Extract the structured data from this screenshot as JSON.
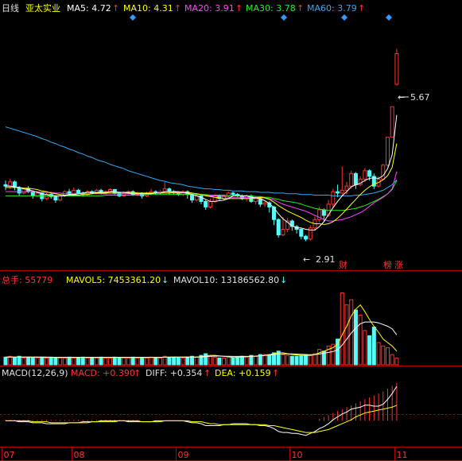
{
  "header": {
    "period": "日线",
    "stock": "亚太实业",
    "ma": [
      {
        "label": "MA5: 4.72",
        "color": "#ffffff"
      },
      {
        "label": "MA10: 4.31",
        "color": "#ffff00"
      },
      {
        "label": "MA20: 3.91",
        "color": "#ff44ff"
      },
      {
        "label": "MA30: 3.78",
        "color": "#22ee22"
      },
      {
        "label": "MA60: 3.79",
        "color": "#33aaee"
      }
    ],
    "arrow": "↑"
  },
  "annotations": {
    "high": "5.67",
    "low": "2.91",
    "tag_cai": "财",
    "tag_bang": "榜",
    "tag_zhang": "涨"
  },
  "volume_header": {
    "total": "总手: 55779",
    "mavol5": "MAVOL5: 7453361.20",
    "mavol10": "MAVOL10: 13186562.80",
    "up_arrow": "↑",
    "down_arrow": "↓"
  },
  "macd_header": {
    "name": "MACD(12,26,9)",
    "macd": "MACD: +0.390",
    "diff": "DIFF: +0.354",
    "dea": "DEA: +0.159",
    "up_arrow": "↑"
  },
  "months": [
    "07",
    "08",
    "09",
    "10",
    "11"
  ],
  "colors": {
    "up": "#ff3232",
    "down": "#54fcfc",
    "axis": "#b00000",
    "ma5": "#ffffff",
    "ma10": "#ffff00",
    "ma20": "#ff44ff",
    "ma30": "#22ee22",
    "ma60": "#33aaee"
  },
  "chart_data": {
    "type": "candlestick",
    "candles": [
      [
        3.72,
        3.7,
        3.78,
        3.64
      ],
      [
        3.7,
        3.76,
        3.8,
        3.66
      ],
      [
        3.76,
        3.68,
        3.78,
        3.64
      ],
      [
        3.68,
        3.6,
        3.7,
        3.56
      ],
      [
        3.6,
        3.66,
        3.68,
        3.58
      ],
      [
        3.66,
        3.62,
        3.7,
        3.6
      ],
      [
        3.62,
        3.56,
        3.64,
        3.52
      ],
      [
        3.56,
        3.6,
        3.62,
        3.54
      ],
      [
        3.6,
        3.52,
        3.62,
        3.48
      ],
      [
        3.52,
        3.58,
        3.6,
        3.5
      ],
      [
        3.58,
        3.55,
        3.6,
        3.52
      ],
      [
        3.55,
        3.5,
        3.57,
        3.46
      ],
      [
        3.5,
        3.56,
        3.58,
        3.48
      ],
      [
        3.56,
        3.62,
        3.64,
        3.54
      ],
      [
        3.62,
        3.58,
        3.66,
        3.56
      ],
      [
        3.58,
        3.64,
        3.68,
        3.56
      ],
      [
        3.64,
        3.6,
        3.66,
        3.58
      ],
      [
        3.6,
        3.58,
        3.62,
        3.55
      ],
      [
        3.58,
        3.62,
        3.64,
        3.56
      ],
      [
        3.62,
        3.6,
        3.64,
        3.58
      ],
      [
        3.6,
        3.64,
        3.66,
        3.59
      ],
      [
        3.64,
        3.6,
        3.66,
        3.58
      ],
      [
        3.6,
        3.62,
        3.64,
        3.58
      ],
      [
        3.62,
        3.65,
        3.67,
        3.6
      ],
      [
        3.65,
        3.6,
        3.66,
        3.58
      ],
      [
        3.6,
        3.56,
        3.62,
        3.54
      ],
      [
        3.56,
        3.6,
        3.62,
        3.55
      ],
      [
        3.6,
        3.62,
        3.64,
        3.58
      ],
      [
        3.62,
        3.58,
        3.64,
        3.56
      ],
      [
        3.58,
        3.6,
        3.62,
        3.56
      ],
      [
        3.6,
        3.56,
        3.61,
        3.52
      ],
      [
        3.56,
        3.6,
        3.62,
        3.54
      ],
      [
        3.6,
        3.62,
        3.66,
        3.58
      ],
      [
        3.62,
        3.6,
        3.64,
        3.58
      ],
      [
        3.6,
        3.62,
        3.64,
        3.58
      ],
      [
        3.62,
        3.66,
        3.76,
        3.6
      ],
      [
        3.66,
        3.62,
        3.68,
        3.58
      ],
      [
        3.62,
        3.6,
        3.64,
        3.58
      ],
      [
        3.6,
        3.58,
        3.62,
        3.56
      ],
      [
        3.58,
        3.62,
        3.64,
        3.56
      ],
      [
        3.62,
        3.58,
        3.64,
        3.52
      ],
      [
        3.58,
        3.5,
        3.6,
        3.46
      ],
      [
        3.5,
        3.56,
        3.58,
        3.48
      ],
      [
        3.56,
        3.48,
        3.58,
        3.44
      ],
      [
        3.48,
        3.4,
        3.5,
        3.36
      ],
      [
        3.4,
        3.48,
        3.52,
        3.38
      ],
      [
        3.48,
        3.56,
        3.58,
        3.46
      ],
      [
        3.56,
        3.52,
        3.58,
        3.5
      ],
      [
        3.52,
        3.56,
        3.58,
        3.5
      ],
      [
        3.56,
        3.6,
        3.62,
        3.54
      ],
      [
        3.6,
        3.58,
        3.62,
        3.56
      ],
      [
        3.58,
        3.56,
        3.6,
        3.54
      ],
      [
        3.56,
        3.52,
        3.58,
        3.5
      ],
      [
        3.52,
        3.56,
        3.58,
        3.48
      ],
      [
        3.56,
        3.48,
        3.58,
        3.46
      ],
      [
        3.48,
        3.52,
        3.54,
        3.44
      ],
      [
        3.52,
        3.44,
        3.54,
        3.4
      ],
      [
        3.44,
        3.46,
        3.48,
        3.4
      ],
      [
        3.46,
        3.4,
        3.48,
        3.32
      ],
      [
        3.4,
        3.22,
        3.42,
        3.14
      ],
      [
        3.22,
        3.0,
        3.24,
        2.96
      ],
      [
        3.0,
        3.08,
        3.26,
        2.98
      ],
      [
        3.08,
        3.2,
        3.24,
        3.04
      ],
      [
        3.2,
        3.12,
        3.22,
        3.06
      ],
      [
        3.12,
        3.08,
        3.14,
        3.02
      ],
      [
        3.08,
        2.98,
        3.1,
        2.94
      ],
      [
        2.98,
        2.94,
        3.0,
        2.91
      ],
      [
        2.94,
        3.1,
        3.14,
        2.92
      ],
      [
        3.1,
        3.22,
        3.26,
        3.06
      ],
      [
        3.22,
        3.36,
        3.4,
        3.18
      ],
      [
        3.36,
        3.28,
        3.38,
        3.2
      ],
      [
        3.28,
        3.44,
        3.5,
        3.26
      ],
      [
        3.44,
        3.62,
        3.66,
        3.4
      ],
      [
        3.62,
        3.6,
        3.72,
        3.54
      ],
      [
        3.6,
        3.64,
        3.98,
        3.56
      ],
      [
        3.64,
        3.7,
        3.76,
        3.58
      ],
      [
        3.7,
        3.88,
        3.92,
        3.66
      ],
      [
        3.88,
        3.72,
        3.9,
        3.66
      ],
      [
        3.72,
        3.8,
        3.84,
        3.7
      ],
      [
        3.8,
        3.92,
        3.96,
        3.76
      ],
      [
        3.92,
        3.84,
        3.94,
        3.78
      ],
      [
        3.84,
        3.7,
        3.88,
        3.66
      ],
      [
        3.7,
        3.8,
        3.84,
        3.68
      ],
      [
        3.8,
        4.0,
        4.02,
        3.78
      ],
      [
        4.0,
        4.4,
        4.4,
        3.98
      ],
      [
        4.4,
        4.84,
        4.84,
        4.4
      ],
      [
        5.16,
        5.6,
        5.67,
        5.14
      ]
    ],
    "ma5": [
      3.7,
      3.7,
      3.69,
      3.68,
      3.66,
      3.65,
      3.63,
      3.61,
      3.59,
      3.58,
      3.57,
      3.56,
      3.56,
      3.56,
      3.58,
      3.58,
      3.59,
      3.6,
      3.61,
      3.61,
      3.61,
      3.61,
      3.61,
      3.62,
      3.62,
      3.61,
      3.61,
      3.6,
      3.59,
      3.59,
      3.59,
      3.59,
      3.59,
      3.6,
      3.6,
      3.62,
      3.62,
      3.62,
      3.62,
      3.61,
      3.6,
      3.58,
      3.56,
      3.54,
      3.51,
      3.48,
      3.48,
      3.49,
      3.5,
      3.52,
      3.56,
      3.57,
      3.56,
      3.56,
      3.54,
      3.53,
      3.52,
      3.49,
      3.45,
      3.39,
      3.3,
      3.23,
      3.18,
      3.13,
      3.1,
      3.1,
      3.08,
      3.07,
      3.07,
      3.12,
      3.19,
      3.29,
      3.39,
      3.48,
      3.56,
      3.62,
      3.69,
      3.72,
      3.74,
      3.78,
      3.81,
      3.82,
      3.81,
      3.85,
      3.95,
      4.15,
      4.72
    ],
    "ma10": [
      3.68,
      3.68,
      3.68,
      3.68,
      3.67,
      3.67,
      3.66,
      3.65,
      3.63,
      3.62,
      3.6,
      3.59,
      3.58,
      3.57,
      3.57,
      3.57,
      3.57,
      3.58,
      3.58,
      3.59,
      3.6,
      3.6,
      3.6,
      3.61,
      3.61,
      3.61,
      3.61,
      3.61,
      3.61,
      3.6,
      3.6,
      3.6,
      3.6,
      3.6,
      3.6,
      3.6,
      3.6,
      3.61,
      3.61,
      3.61,
      3.61,
      3.6,
      3.59,
      3.58,
      3.56,
      3.55,
      3.54,
      3.53,
      3.52,
      3.52,
      3.52,
      3.52,
      3.52,
      3.52,
      3.52,
      3.53,
      3.54,
      3.53,
      3.51,
      3.47,
      3.42,
      3.38,
      3.34,
      3.31,
      3.28,
      3.25,
      3.21,
      3.18,
      3.16,
      3.16,
      3.15,
      3.16,
      3.19,
      3.24,
      3.3,
      3.37,
      3.44,
      3.51,
      3.58,
      3.64,
      3.69,
      3.73,
      3.75,
      3.79,
      3.85,
      3.97,
      4.31
    ],
    "ma20": [
      3.62,
      3.62,
      3.62,
      3.62,
      3.62,
      3.62,
      3.62,
      3.62,
      3.61,
      3.61,
      3.61,
      3.6,
      3.6,
      3.59,
      3.59,
      3.59,
      3.59,
      3.59,
      3.59,
      3.59,
      3.59,
      3.59,
      3.59,
      3.59,
      3.59,
      3.59,
      3.59,
      3.59,
      3.59,
      3.59,
      3.59,
      3.59,
      3.59,
      3.6,
      3.6,
      3.6,
      3.6,
      3.6,
      3.6,
      3.6,
      3.6,
      3.6,
      3.59,
      3.58,
      3.57,
      3.56,
      3.56,
      3.55,
      3.55,
      3.54,
      3.54,
      3.54,
      3.54,
      3.54,
      3.54,
      3.54,
      3.54,
      3.53,
      3.52,
      3.5,
      3.47,
      3.44,
      3.42,
      3.4,
      3.38,
      3.36,
      3.34,
      3.31,
      3.28,
      3.25,
      3.22,
      3.2,
      3.2,
      3.21,
      3.22,
      3.24,
      3.26,
      3.29,
      3.32,
      3.36,
      3.41,
      3.46,
      3.5,
      3.54,
      3.59,
      3.66,
      3.91
    ],
    "ma30": [
      3.56,
      3.56,
      3.56,
      3.56,
      3.56,
      3.56,
      3.56,
      3.56,
      3.56,
      3.56,
      3.56,
      3.56,
      3.56,
      3.56,
      3.56,
      3.56,
      3.56,
      3.56,
      3.56,
      3.56,
      3.56,
      3.56,
      3.57,
      3.57,
      3.57,
      3.57,
      3.57,
      3.57,
      3.57,
      3.57,
      3.57,
      3.58,
      3.58,
      3.58,
      3.58,
      3.58,
      3.58,
      3.58,
      3.58,
      3.58,
      3.58,
      3.58,
      3.58,
      3.58,
      3.58,
      3.57,
      3.57,
      3.57,
      3.57,
      3.56,
      3.56,
      3.56,
      3.56,
      3.56,
      3.56,
      3.55,
      3.55,
      3.54,
      3.54,
      3.52,
      3.51,
      3.49,
      3.48,
      3.47,
      3.46,
      3.44,
      3.42,
      3.4,
      3.38,
      3.37,
      3.36,
      3.35,
      3.35,
      3.35,
      3.35,
      3.36,
      3.37,
      3.38,
      3.4,
      3.42,
      3.45,
      3.48,
      3.51,
      3.55,
      3.59,
      3.65,
      3.78
    ],
    "ma60": [
      4.55,
      4.53,
      4.51,
      4.49,
      4.47,
      4.45,
      4.43,
      4.41,
      4.38,
      4.36,
      4.33,
      4.31,
      4.28,
      4.26,
      4.23,
      4.21,
      4.18,
      4.16,
      4.13,
      4.11,
      4.08,
      4.06,
      4.04,
      4.01,
      3.99,
      3.97,
      3.95,
      3.92,
      3.9,
      3.88,
      3.86,
      3.84,
      3.82,
      3.8,
      3.78,
      3.77,
      3.75,
      3.74,
      3.73,
      3.72,
      3.7,
      3.69,
      3.68,
      3.67,
      3.66,
      3.66,
      3.65,
      3.65,
      3.64,
      3.64,
      3.63,
      3.63,
      3.63,
      3.62,
      3.62,
      3.62,
      3.61,
      3.61,
      3.61,
      3.6,
      3.6,
      3.6,
      3.59,
      3.59,
      3.59,
      3.58,
      3.58,
      3.58,
      3.57,
      3.57,
      3.57,
      3.57,
      3.56,
      3.56,
      3.56,
      3.56,
      3.56,
      3.57,
      3.57,
      3.58,
      3.59,
      3.6,
      3.62,
      3.64,
      3.68,
      3.72,
      3.79
    ],
    "volume": [
      9,
      10,
      8,
      10,
      8,
      9,
      8,
      8,
      9,
      8,
      9,
      8,
      8,
      8,
      9,
      8,
      8,
      9,
      8,
      8,
      8,
      9,
      8,
      8,
      9,
      8,
      8,
      8,
      9,
      8,
      8,
      8,
      9,
      8,
      8,
      10,
      9,
      9,
      8,
      8,
      9,
      10,
      9,
      11,
      13,
      10,
      9,
      8,
      8,
      9,
      8,
      9,
      10,
      9,
      11,
      10,
      12,
      12,
      12,
      14,
      16,
      12,
      11,
      10,
      10,
      11,
      12,
      11,
      13,
      18,
      16,
      22,
      24,
      30,
      84,
      70,
      76,
      64,
      58,
      40,
      34,
      44,
      26,
      22,
      20,
      12,
      8
    ],
    "mavol5": [
      9,
      9,
      9,
      9,
      9,
      9,
      9,
      9,
      8.5,
      8.5,
      8.5,
      8.5,
      8.5,
      8.5,
      8.5,
      8.5,
      8.5,
      8.5,
      8.5,
      8.5,
      8.5,
      8.5,
      8.5,
      8.5,
      8.5,
      8.5,
      8.5,
      8.5,
      8.5,
      8.5,
      8.5,
      8.5,
      8.5,
      8.5,
      8.5,
      9,
      9,
      9,
      9,
      9,
      9,
      9,
      9,
      9.5,
      10.5,
      11,
      11,
      10.5,
      10,
      9.5,
      8.5,
      8.5,
      9,
      9.5,
      10,
      10,
      10.5,
      11,
      12,
      13,
      14,
      14,
      13,
      12,
      11.5,
      11,
      11,
      11,
      12,
      14,
      16,
      18,
      20,
      24,
      35,
      45,
      57,
      65,
      70,
      62,
      53,
      45,
      38,
      30,
      26,
      22,
      16
    ],
    "mavol10": [
      9,
      9,
      9,
      9,
      9,
      9,
      9,
      9,
      9,
      9,
      8.8,
      8.8,
      8.8,
      8.8,
      8.8,
      8.8,
      8.8,
      8.8,
      8.8,
      8.8,
      8.8,
      8.8,
      8.8,
      8.8,
      8.8,
      8.8,
      8.8,
      8.8,
      8.8,
      8.8,
      8.8,
      8.8,
      8.8,
      8.8,
      8.8,
      8.8,
      8.8,
      9,
      9,
      9,
      9,
      9,
      9,
      9.2,
      9.5,
      10,
      10.2,
      10.2,
      10,
      10,
      9.8,
      9.8,
      9.8,
      9.8,
      10,
      10.2,
      10.6,
      11,
      11.5,
      12,
      12.5,
      12.7,
      12.8,
      12.7,
      12.5,
      12.3,
      12,
      11.8,
      12,
      12.6,
      13.5,
      14.5,
      15.5,
      17.5,
      23,
      30,
      37,
      43,
      48,
      50,
      50,
      50,
      49,
      47,
      45,
      42,
      35
    ],
    "diff": [
      0,
      0,
      0,
      -0.01,
      -0.01,
      -0.01,
      -0.02,
      -0.02,
      -0.02,
      -0.03,
      -0.03,
      -0.03,
      -0.03,
      -0.03,
      -0.02,
      -0.02,
      -0.02,
      -0.01,
      -0.01,
      -0.01,
      -0.01,
      0,
      0,
      0,
      0,
      0,
      0,
      -0.01,
      -0.01,
      -0.01,
      -0.01,
      -0.01,
      -0.01,
      0,
      0,
      0,
      0,
      0,
      0,
      0,
      -0.01,
      -0.02,
      -0.02,
      -0.03,
      -0.05,
      -0.05,
      -0.05,
      -0.05,
      -0.04,
      -0.04,
      -0.03,
      -0.03,
      -0.03,
      -0.03,
      -0.04,
      -0.04,
      -0.05,
      -0.05,
      -0.06,
      -0.08,
      -0.11,
      -0.12,
      -0.12,
      -0.13,
      -0.13,
      -0.14,
      -0.15,
      -0.13,
      -0.11,
      -0.08,
      -0.06,
      -0.03,
      0.01,
      0.04,
      0.07,
      0.09,
      0.12,
      0.13,
      0.14,
      0.16,
      0.16,
      0.15,
      0.15,
      0.17,
      0.22,
      0.28,
      0.354
    ],
    "dea": [
      0,
      0,
      0,
      0,
      0,
      0,
      -0.01,
      -0.01,
      -0.01,
      -0.01,
      -0.02,
      -0.02,
      -0.02,
      -0.02,
      -0.02,
      -0.02,
      -0.02,
      -0.02,
      -0.02,
      -0.01,
      -0.01,
      -0.01,
      -0.01,
      -0.01,
      -0.01,
      0,
      0,
      0,
      0,
      0,
      -0.01,
      -0.01,
      -0.01,
      -0.01,
      -0.01,
      0,
      0,
      0,
      0,
      0,
      0,
      -0.01,
      -0.01,
      -0.01,
      -0.02,
      -0.03,
      -0.03,
      -0.04,
      -0.04,
      -0.04,
      -0.04,
      -0.04,
      -0.04,
      -0.04,
      -0.04,
      -0.04,
      -0.04,
      -0.04,
      -0.05,
      -0.05,
      -0.06,
      -0.07,
      -0.08,
      -0.09,
      -0.1,
      -0.11,
      -0.12,
      -0.12,
      -0.12,
      -0.11,
      -0.1,
      -0.09,
      -0.07,
      -0.05,
      -0.03,
      -0.01,
      0.01,
      0.04,
      0.06,
      0.08,
      0.09,
      0.1,
      0.11,
      0.12,
      0.13,
      0.14,
      0.159
    ],
    "macd": [
      0.01,
      0.01,
      0.01,
      0.01,
      0.01,
      0.01,
      0.01,
      0.01,
      0.01,
      0.01,
      0.01,
      0.01,
      0.01,
      0.01,
      0.01,
      0.01,
      0.01,
      0.01,
      0.01,
      0.01,
      0.01,
      0.01,
      0.01,
      0.01,
      0.01,
      0.01,
      0.01,
      0.01,
      0.01,
      0.01,
      0,
      0,
      0,
      0,
      0,
      0,
      0,
      0,
      0,
      0,
      0,
      0,
      0,
      0,
      0,
      0,
      0,
      0,
      0,
      0,
      0,
      0,
      0,
      0,
      0,
      0,
      0,
      0,
      0,
      0,
      0,
      0,
      0,
      0,
      0,
      0,
      0,
      0,
      0,
      0.02,
      0.04,
      0.06,
      0.08,
      0.1,
      0.12,
      0.14,
      0.16,
      0.18,
      0.2,
      0.22,
      0.24,
      0.26,
      0.28,
      0.3,
      0.33,
      0.36,
      0.39
    ],
    "price_range": [
      2.55,
      6.05
    ],
    "volume_range": [
      0,
      90
    ],
    "macd_range": [
      -0.25,
      0.42
    ],
    "month_boundaries": [
      0,
      15,
      38,
      63,
      86
    ]
  }
}
